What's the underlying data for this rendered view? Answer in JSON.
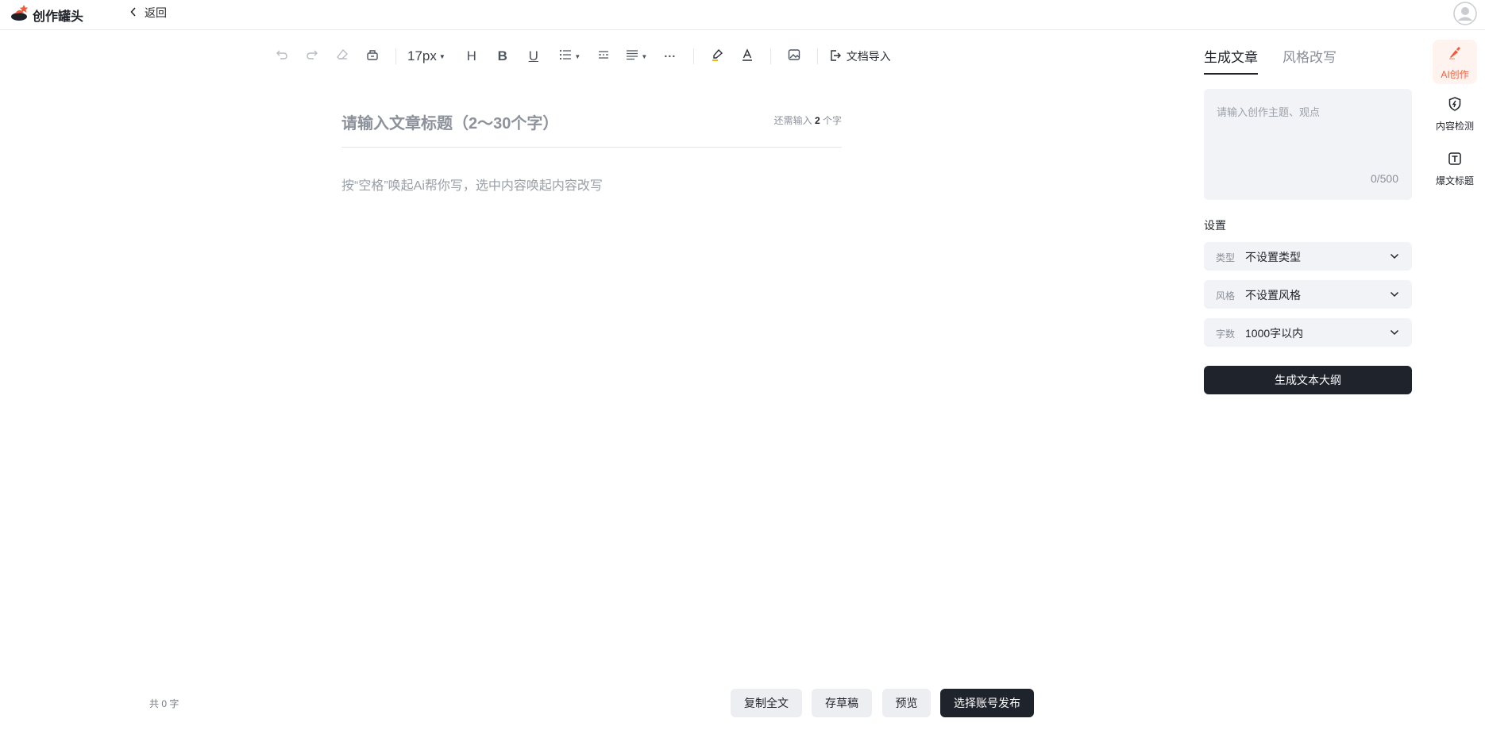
{
  "header": {
    "logo_text": "创作罐头",
    "back_label": "返回"
  },
  "toolbar": {
    "font_size": "17px",
    "heading": "H",
    "bold": "B",
    "underline": "U",
    "more": "···",
    "import_label": "文档导入"
  },
  "editor": {
    "title_placeholder": "请输入文章标题（2～30个字）",
    "title_hint_prefix": "还需输入",
    "title_hint_count": "2",
    "title_hint_suffix": "个字",
    "body_placeholder": "按“空格”唤起Ai帮你写，选中内容唤起内容改写"
  },
  "footer": {
    "word_count": "共 0 字",
    "copy_all": "复制全文",
    "save_draft": "存草稿",
    "preview": "预览",
    "publish": "选择账号发布"
  },
  "panel": {
    "tabs": [
      {
        "label": "生成文章"
      },
      {
        "label": "风格改写"
      }
    ],
    "prompt_placeholder": "请输入创作主题、观点",
    "prompt_count": "0/500",
    "settings_label": "设置",
    "selects": [
      {
        "label": "类型",
        "value": "不设置类型"
      },
      {
        "label": "风格",
        "value": "不设置风格"
      },
      {
        "label": "字数",
        "value": "1000字以内"
      }
    ],
    "generate_button": "生成文本大纲"
  },
  "side_tools": [
    {
      "label": "AI创作"
    },
    {
      "label": "内容检测"
    },
    {
      "label": "爆文标题"
    }
  ],
  "colors": {
    "accent": "#f25b3a",
    "dark": "#1f232c",
    "panel_bg": "#f2f3f6"
  }
}
